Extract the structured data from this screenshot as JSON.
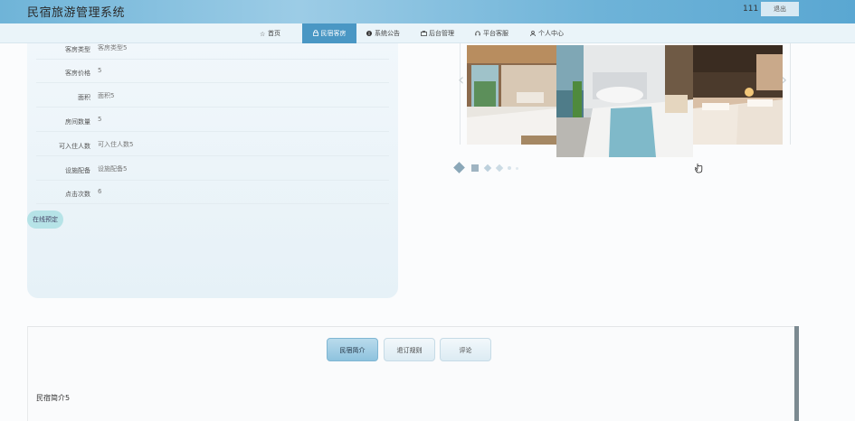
{
  "header": {
    "site_title": "民宿旅游管理系统",
    "user_name": "111",
    "logout_label": "退出"
  },
  "nav": {
    "items": [
      {
        "label": "首页",
        "icon": "star-icon"
      },
      {
        "label": "民宿客房",
        "icon": "lock-icon",
        "active": true
      },
      {
        "label": "系统公告",
        "icon": "info-icon"
      },
      {
        "label": "后台管理",
        "icon": "briefcase-icon"
      },
      {
        "label": "平台客服",
        "icon": "headset-icon"
      },
      {
        "label": "个人中心",
        "icon": "user-icon"
      }
    ]
  },
  "detail": {
    "rows": [
      {
        "label": "客房类型",
        "value": "客房类型5"
      },
      {
        "label": "客房价格",
        "value": "5"
      },
      {
        "label": "面积",
        "value": "面积5"
      },
      {
        "label": "房间数量",
        "value": "5"
      },
      {
        "label": "可入住人数",
        "value": "可入住人数5"
      },
      {
        "label": "设施配备",
        "value": "设施配备5"
      },
      {
        "label": "点击次数",
        "value": "6"
      }
    ],
    "book_label": "在线预定"
  },
  "carousel": {
    "slides": [
      "bedroom-wood-window",
      "bedroom-bathtub-sea-view",
      "bedroom-twin-warm-light"
    ],
    "accent": "#4a97c4"
  },
  "tabs": {
    "items": [
      {
        "label": "民宿简介",
        "active": true
      },
      {
        "label": "退订规则"
      },
      {
        "label": "评论"
      }
    ],
    "content": "民宿简介5"
  },
  "colors": {
    "header": "#6fb4d8",
    "nav_active": "#4a97c4",
    "panel": "#eaf3f8",
    "book_button": "#b6e3e7"
  }
}
